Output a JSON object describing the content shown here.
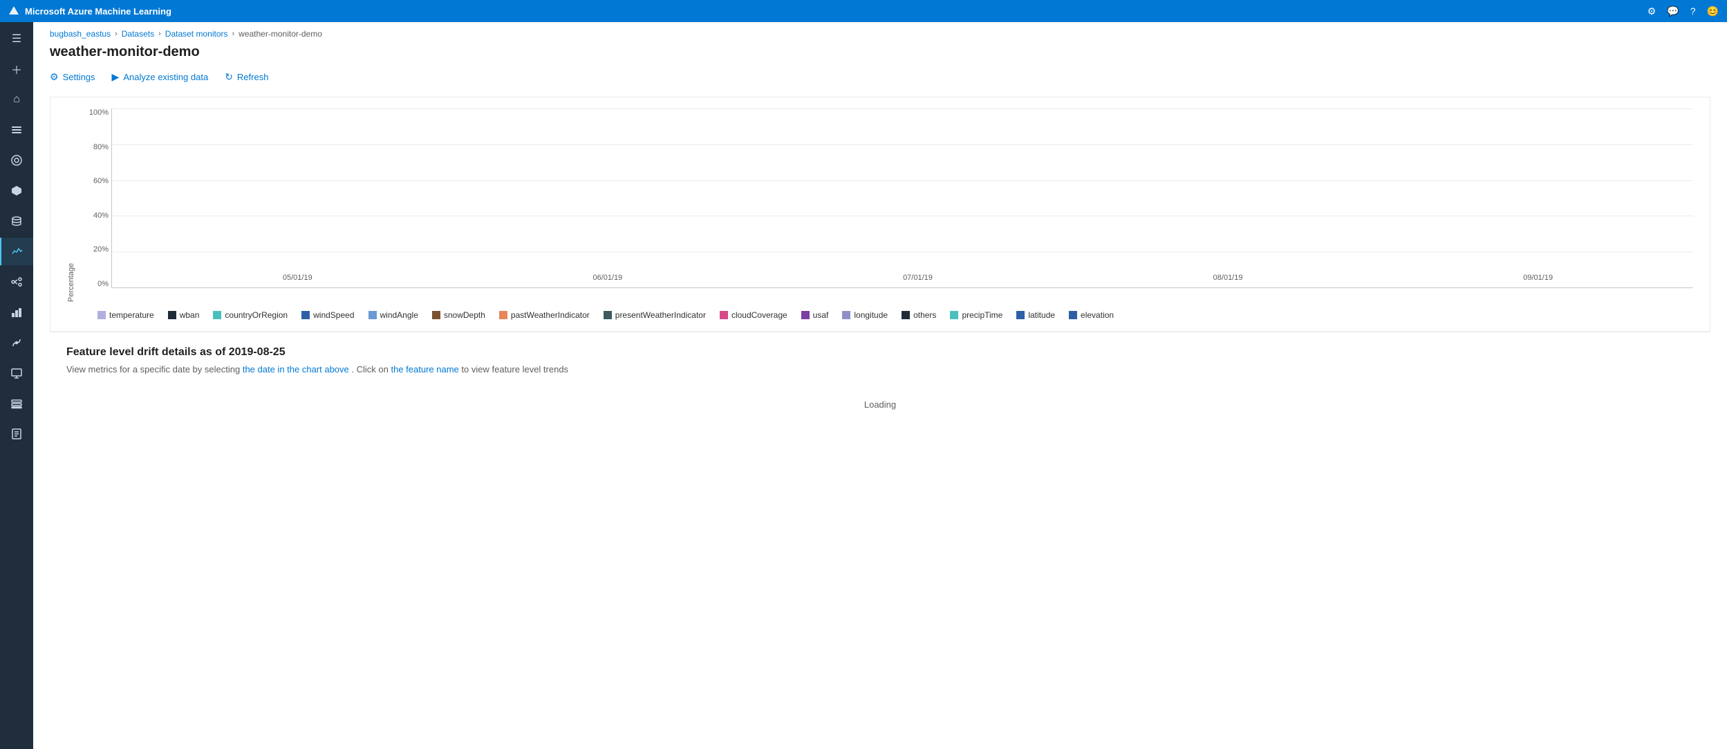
{
  "topbar": {
    "title": "Microsoft Azure Machine Learning",
    "icons": [
      "settings-icon",
      "chat-icon",
      "help-icon",
      "user-icon"
    ]
  },
  "breadcrumb": {
    "items": [
      "bugbash_eastus",
      "Datasets",
      "Dataset monitors",
      "weather-monitor-demo"
    ],
    "separators": [
      ">",
      ">",
      ">"
    ]
  },
  "page": {
    "title": "weather-monitor-demo"
  },
  "toolbar": {
    "settings_label": "Settings",
    "analyze_label": "Analyze existing data",
    "refresh_label": "Refresh"
  },
  "chart": {
    "y_axis_label": "Percentage",
    "y_ticks": [
      "100%",
      "80%",
      "60%",
      "40%",
      "20%",
      "0%"
    ],
    "x_ticks": [
      "05/01/19",
      "06/01/19",
      "07/01/19",
      "08/01/19",
      "09/01/19"
    ]
  },
  "legend": {
    "items": [
      {
        "label": "temperature",
        "color": "#b3aee0"
      },
      {
        "label": "wban",
        "color": "#1f2b38"
      },
      {
        "label": "countryOrRegion",
        "color": "#4bbfbf"
      },
      {
        "label": "windSpeed",
        "color": "#2d5fa6"
      },
      {
        "label": "windAngle",
        "color": "#6b9bd2"
      },
      {
        "label": "snowDepth",
        "color": "#7a5230"
      },
      {
        "label": "pastWeatherIndicator",
        "color": "#e8855a"
      },
      {
        "label": "presentWeatherIndicator",
        "color": "#3d5a5e"
      },
      {
        "label": "cloudCoverage",
        "color": "#d64888"
      },
      {
        "label": "usaf",
        "color": "#7b3fa0"
      },
      {
        "label": "longitude",
        "color": "#9090c8"
      },
      {
        "label": "others",
        "color": "#1f2b38"
      },
      {
        "label": "precipTime",
        "color": "#4bbfbf"
      },
      {
        "label": "latitude",
        "color": "#2d5fa6"
      },
      {
        "label": "elevation",
        "color": "#2d5fa6"
      }
    ]
  },
  "drift": {
    "title": "Feature level drift details as of 2019-08-25",
    "subtitle_pre": "View metrics for a specific date by selecting",
    "subtitle_link1": "the date in the chart above",
    "subtitle_mid": ". Click on",
    "subtitle_link2": "the feature name",
    "subtitle_post": "to view feature level trends",
    "loading": "Loading"
  },
  "sidebar": {
    "items": [
      {
        "icon": "☰",
        "name": "menu-icon"
      },
      {
        "icon": "+",
        "name": "create-icon"
      },
      {
        "icon": "⌂",
        "name": "home-icon"
      },
      {
        "icon": "≡",
        "name": "jobs-icon"
      },
      {
        "icon": "◈",
        "name": "assets-icon"
      },
      {
        "icon": "⬡",
        "name": "components-icon"
      },
      {
        "icon": "⛁",
        "name": "data-icon"
      },
      {
        "icon": "◉",
        "name": "monitor-icon"
      },
      {
        "icon": "⚗",
        "name": "pipelines-icon"
      },
      {
        "icon": "⬢",
        "name": "models-icon"
      },
      {
        "icon": "☁",
        "name": "endpoints-icon"
      },
      {
        "icon": "◫",
        "name": "compute-icon"
      },
      {
        "icon": "≋",
        "name": "storage-icon"
      },
      {
        "icon": "✎",
        "name": "notebooks-icon"
      }
    ]
  }
}
